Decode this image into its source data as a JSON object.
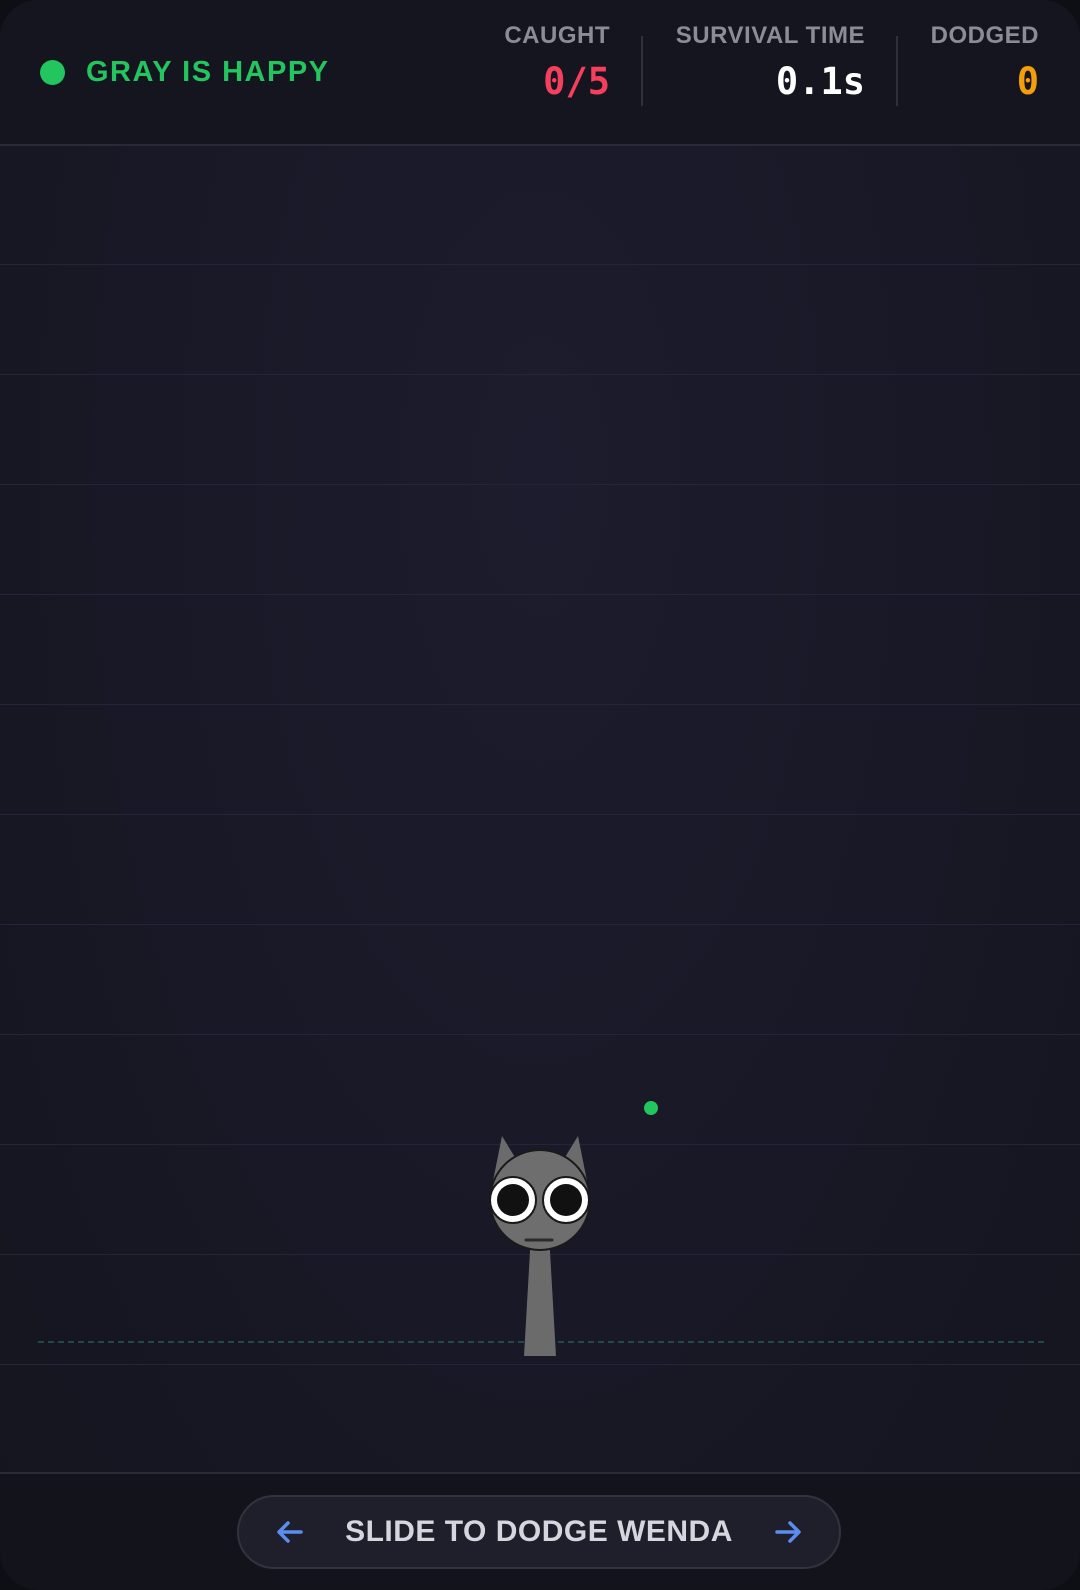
{
  "status": {
    "text": "GRAY IS HAPPY",
    "color": "#22c55e"
  },
  "stats": {
    "caught": {
      "label": "CAUGHT",
      "value": "0/5",
      "color": "#f43f5e"
    },
    "survival": {
      "label": "SURVIVAL TIME",
      "value": "0.1s",
      "color": "#ffffff"
    },
    "dodged": {
      "label": "DODGED",
      "value": "0",
      "color": "#f59e0b"
    }
  },
  "character": {
    "name": "gray",
    "body_color": "#6b6b6b"
  },
  "controls": {
    "slide_label": "SLIDE TO DODGE WENDA",
    "left_icon": "arrow-left-icon",
    "right_icon": "arrow-right-icon",
    "arrow_color": "#5b8def"
  }
}
